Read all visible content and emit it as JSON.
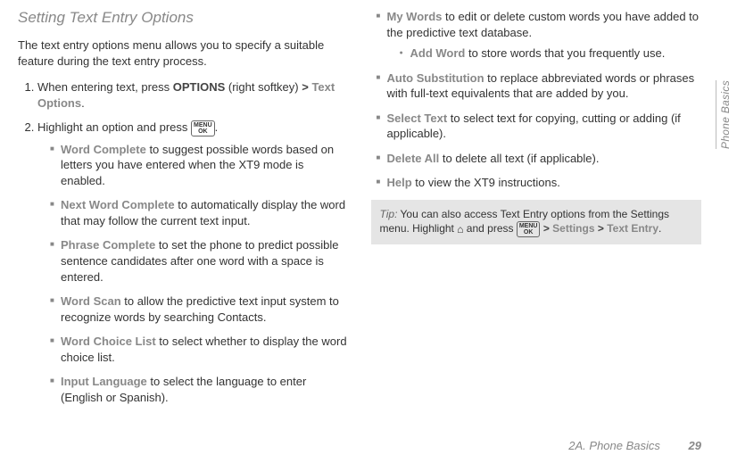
{
  "sideTab": "Phone Basics",
  "footer": {
    "section": "2A. Phone Basics",
    "page": "29"
  },
  "left": {
    "title": "Setting Text Entry Options",
    "intro": "The text entry options menu allows you to specify a suitable feature during the text entry process.",
    "step1_a": "When entering text, press ",
    "step1_opt": "OPTIONS",
    "step1_b": " (right softkey) ",
    "step1_gt": ">",
    "step1_c": " ",
    "step1_textopt": "Text Options",
    "step1_d": ".",
    "step2_a": "Highlight an option and press ",
    "step2_b": ".",
    "keyOk": "MENU\nOK",
    "bullets": [
      {
        "term": "Word Complete",
        "rest": " to suggest possible words based on letters you have entered when the XT9 mode is enabled."
      },
      {
        "term": "Next Word Complete",
        "rest": " to automatically display the word that may follow the current text input."
      },
      {
        "term": "Phrase Complete",
        "rest": " to set the phone to predict possible sentence candidates after one word with a space is entered."
      },
      {
        "term": "Word Scan",
        "rest": " to allow the predictive text input system to recognize words by searching Contacts."
      },
      {
        "term": "Word Choice List",
        "rest": " to select whether to display the word choice list."
      },
      {
        "term": "Input Language",
        "rest": " to select the language to enter (English or Spanish)."
      }
    ]
  },
  "right": {
    "bullets1": {
      "term": "My Words",
      "rest": " to edit or delete custom words you have added to the predictive text database.",
      "sub": {
        "term": "Add Word",
        "rest": " to store words that you frequently use."
      }
    },
    "bullets2": [
      {
        "term": "Auto Substitution",
        "rest": " to replace abbreviated words or phrases with full-text equivalents that are added by you."
      },
      {
        "term": "Select Text",
        "rest": " to select text for copying, cutting or adding (if applicable)."
      },
      {
        "term": "Delete All",
        "rest": " to delete all text (if applicable)."
      },
      {
        "term": "Help",
        "rest": " to view the XT9 instructions."
      }
    ],
    "tip": {
      "label": "Tip:",
      "a": " You can also access Text Entry options from the Settings menu. Highlight ",
      "home": "⌂",
      "b": " and press ",
      "c": " ",
      "gt1": ">",
      "settings": "Settings",
      "gt2": ">",
      "textentry": "Text Entry",
      "d": "."
    }
  }
}
